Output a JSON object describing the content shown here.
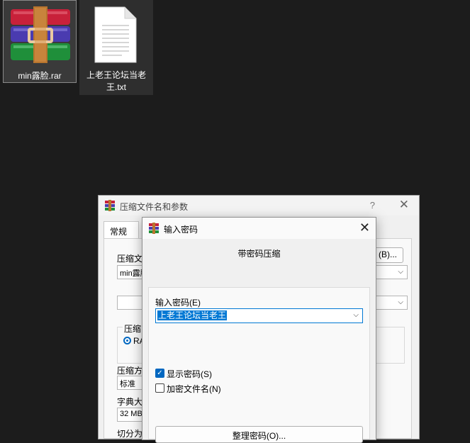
{
  "desktop": {
    "icons": [
      {
        "name": "min露脸.rar"
      },
      {
        "name_line1": "上老王论坛当老",
        "name_line2": "王.txt"
      }
    ]
  },
  "compress_dialog": {
    "title": "压缩文件名和参数",
    "help": "?",
    "close": "✕",
    "tab_general": "常规",
    "archive_name_label": "压缩文",
    "archive_name_value": "min露脸",
    "browse_button": "(B)...",
    "format_group_label": "压缩",
    "rar_option": "RA",
    "method_label": "压缩方",
    "method_value": "标准",
    "dict_label": "字典大",
    "dict_value": "32 MB",
    "split_label": "切分为"
  },
  "password_dialog": {
    "title": "输入密码",
    "close": "✕",
    "heading": "带密码压缩",
    "password_label": "输入密码(E)",
    "password_value": "上老王论坛当老王",
    "show_password_label": "显示密码(S)",
    "show_password_checked": true,
    "encrypt_names_label": "加密文件名(N)",
    "encrypt_names_checked": false,
    "organize_button": "整理密码(O)..."
  },
  "colors": {
    "accent": "#0078d4",
    "desktop_bg": "#1c1c1c"
  }
}
